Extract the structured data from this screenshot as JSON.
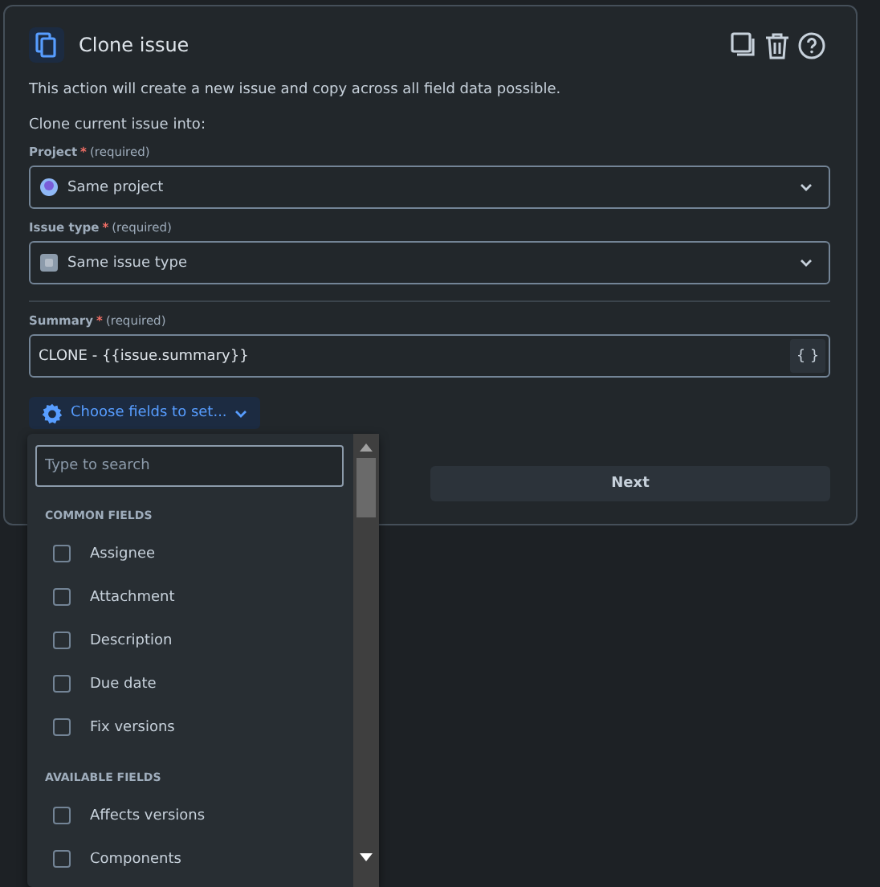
{
  "header": {
    "title": "Clone issue"
  },
  "description": "This action will create a new issue and copy across all field data possible.",
  "clone_into_label": "Clone current issue into:",
  "fields": [
    {
      "kind": "select",
      "label": "Project",
      "required_mark": "*",
      "required_note": "(required)",
      "value": "Same project"
    },
    {
      "kind": "select",
      "label": "Issue type",
      "required_mark": "*",
      "required_note": "(required)",
      "value": "Same issue type"
    },
    {
      "kind": "text",
      "label": "Summary",
      "required_mark": "*",
      "required_note": "(required)",
      "value": "CLONE - {{issue.summary}}",
      "addon": "{ }"
    }
  ],
  "choose_fields_button": {
    "label": "Choose fields to set...",
    "expanded": true
  },
  "next_button": "Next",
  "dropdown": {
    "search_placeholder": "Type to search",
    "groups": [
      {
        "heading": "COMMON FIELDS",
        "items": [
          {
            "label": "Assignee",
            "checked": false
          },
          {
            "label": "Attachment",
            "checked": false
          },
          {
            "label": "Description",
            "checked": false
          },
          {
            "label": "Due date",
            "checked": false
          },
          {
            "label": "Fix versions",
            "checked": false
          }
        ]
      },
      {
        "heading": "AVAILABLE FIELDS",
        "items": [
          {
            "label": "Affects versions",
            "checked": false
          },
          {
            "label": "Components",
            "checked": false
          }
        ]
      }
    ]
  }
}
